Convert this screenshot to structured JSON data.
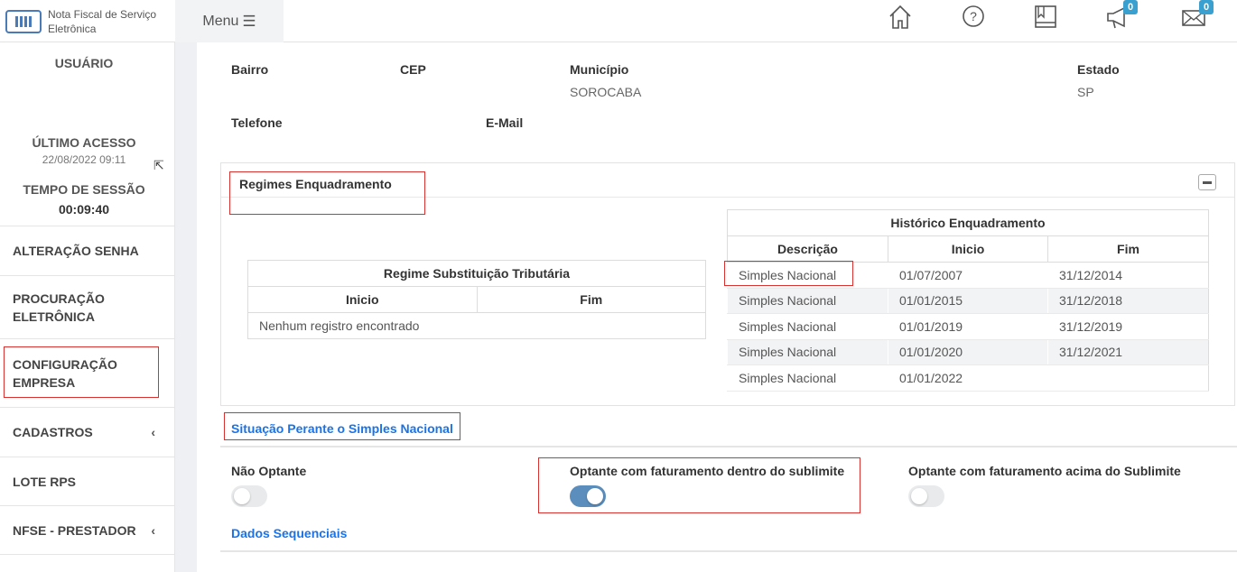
{
  "header": {
    "brand_line1": "Nota Fiscal de Serviço",
    "brand_line2": "Eletrônica",
    "menu_label": "Menu",
    "notifications_count": "0",
    "messages_count": "0"
  },
  "sidebar": {
    "user_label": "USUÁRIO",
    "last_access_label": "ÚLTIMO ACESSO",
    "last_access_value": "22/08/2022 09:11",
    "session_label": "TEMPO DE SESSÃO",
    "session_value": "00:09:40",
    "items": [
      {
        "label": "ALTERAÇÃO SENHA"
      },
      {
        "label": "PROCURAÇÃO ELETRÔNICA"
      },
      {
        "label": "CONFIGURAÇÃO EMPRESA"
      },
      {
        "label": "CADASTROS"
      },
      {
        "label": "LOTE RPS"
      },
      {
        "label": "NFSE - PRESTADOR"
      }
    ]
  },
  "address": {
    "bairro_label": "Bairro",
    "cep_label": "CEP",
    "municipio_label": "Município",
    "municipio_value": "SOROCABA",
    "estado_label": "Estado",
    "estado_value": "SP",
    "telefone_label": "Telefone",
    "email_label": "E-Mail"
  },
  "regimes": {
    "title": "Regimes Enquadramento",
    "substituicao": {
      "title": "Regime Substituição Tributária",
      "headers": [
        "Inicio",
        "Fim"
      ],
      "empty": "Nenhum registro encontrado"
    },
    "historico": {
      "title": "Histórico Enquadramento",
      "headers": [
        "Descrição",
        "Inicio",
        "Fim"
      ],
      "rows": [
        [
          "Simples Nacional",
          "01/07/2007",
          "31/12/2014"
        ],
        [
          "Simples Nacional",
          "01/01/2015",
          "31/12/2018"
        ],
        [
          "Simples Nacional",
          "01/01/2019",
          "31/12/2019"
        ],
        [
          "Simples Nacional",
          "01/01/2020",
          "31/12/2021"
        ],
        [
          "Simples Nacional",
          "01/01/2022",
          ""
        ]
      ]
    }
  },
  "simples": {
    "title": "Situação Perante o Simples Nacional",
    "options": [
      {
        "label": "Não Optante",
        "on": false
      },
      {
        "label": "Optante com faturamento dentro do sublimite",
        "on": true
      },
      {
        "label": "Optante com faturamento acima do Sublimite",
        "on": false
      }
    ]
  },
  "sequenciais": {
    "title": "Dados Sequenciais"
  },
  "colors": {
    "accent": "#1a73e8",
    "toggle_on": "#5b8ebc",
    "highlight": "#d93030"
  }
}
